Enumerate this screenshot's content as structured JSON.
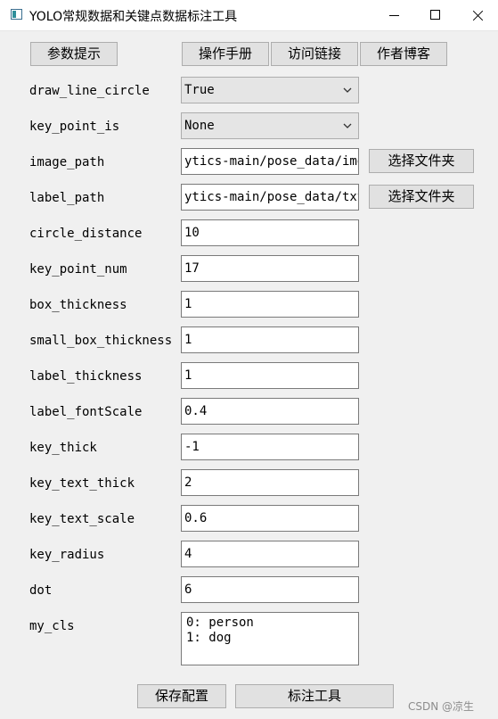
{
  "window": {
    "title": "YOLO常规数据和关键点数据标注工具"
  },
  "toolbar": {
    "params_hint": "参数提示",
    "manual": "操作手册",
    "visit_link": "访问链接",
    "author_blog": "作者博客"
  },
  "fields": {
    "draw_line_circle": {
      "label": "draw_line_circle",
      "value": "True"
    },
    "key_point_is": {
      "label": "key_point_is",
      "value": "None"
    },
    "image_path": {
      "label": "image_path",
      "value": "ytics-main/pose_data/img",
      "button": "选择文件夹"
    },
    "label_path": {
      "label": "label_path",
      "value": "ytics-main/pose_data/txt",
      "button": "选择文件夹"
    },
    "circle_distance": {
      "label": "circle_distance",
      "value": "10"
    },
    "key_point_num": {
      "label": "key_point_num",
      "value": "17"
    },
    "box_thickness": {
      "label": "box_thickness",
      "value": "1"
    },
    "small_box_thickness": {
      "label": "small_box_thickness",
      "value": "1"
    },
    "label_thickness": {
      "label": "label_thickness",
      "value": "1"
    },
    "label_fontScale": {
      "label": "label_fontScale",
      "value": "0.4"
    },
    "key_thick": {
      "label": "key_thick",
      "value": "-1"
    },
    "key_text_thick": {
      "label": "key_text_thick",
      "value": "2"
    },
    "key_text_scale": {
      "label": "key_text_scale",
      "value": "0.6"
    },
    "key_radius": {
      "label": "key_radius",
      "value": "4"
    },
    "dot": {
      "label": "dot",
      "value": "6"
    },
    "my_cls": {
      "label": "my_cls",
      "lines": [
        "0: person",
        "1: dog"
      ]
    }
  },
  "footer": {
    "save_config": "保存配置",
    "annotate_tool": "标注工具",
    "watermark": "CSDN @凉生"
  },
  "colors": {
    "window_bg": "#f0f0f0",
    "button_bg": "#e1e1e1",
    "field_border": "#7a7a7a"
  },
  "icons": {
    "app": "app-window-icon",
    "minimize": "minimize-icon",
    "maximize": "maximize-icon",
    "close": "close-icon",
    "dropdown": "chevron-down-icon"
  }
}
